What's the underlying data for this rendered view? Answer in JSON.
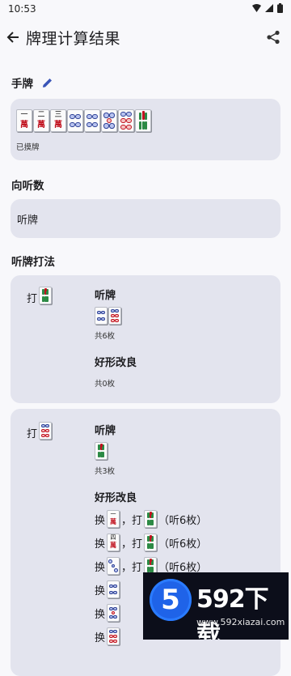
{
  "status": {
    "time": "10:53"
  },
  "appbar": {
    "title": "牌理计算结果"
  },
  "hand": {
    "title": "手牌",
    "drawn_label": "已摸牌",
    "tiles": [
      "1m",
      "2m",
      "3m",
      "4p",
      "4p",
      "5p",
      "6p",
      "7s"
    ]
  },
  "shanten": {
    "title": "向听数",
    "value": "听牌"
  },
  "strategy": {
    "title": "听牌打法",
    "options": [
      {
        "discard_prefix": "打",
        "discard_tile": "7s",
        "wait_label": "听牌",
        "wait_tiles": [
          "4p",
          "6p"
        ],
        "wait_count": "共6枚",
        "improve_label": "好形改良",
        "improve_count": "共0枚"
      },
      {
        "discard_prefix": "打",
        "discard_tile": "6p",
        "wait_label": "听牌",
        "wait_tiles": [
          "7s"
        ],
        "wait_count": "共3枚",
        "improve_label": "好形改良",
        "improvements": [
          {
            "swap": "换",
            "tile": "1m",
            "hit": "，打",
            "discard": "7s",
            "result": "（听6枚）"
          },
          {
            "swap": "换",
            "tile": "4m",
            "hit": "，打",
            "discard": "7s",
            "result": "（听6枚）"
          },
          {
            "swap": "换",
            "tile": "3p",
            "hit": "，打",
            "discard": "7s",
            "result": "（听6枚）"
          },
          {
            "swap": "换",
            "tile": "4p",
            "hit": "",
            "discard": "",
            "result": ""
          },
          {
            "swap": "换",
            "tile": "5p",
            "hit": "",
            "discard": "",
            "result": ""
          },
          {
            "swap": "换",
            "tile": "6p",
            "hit": "",
            "discard": "",
            "result": ""
          }
        ]
      }
    ]
  },
  "watermark": {
    "digits": "592",
    "chars": "下载",
    "mark": "5",
    "url": "www.592xiazai.com"
  },
  "colors": {
    "card_bg": "#e3e4ee",
    "accent": "#3a55b8",
    "man_red": "#c1121f",
    "sou_green": "#2c8a45",
    "pin_blue": "#2b3f95"
  }
}
